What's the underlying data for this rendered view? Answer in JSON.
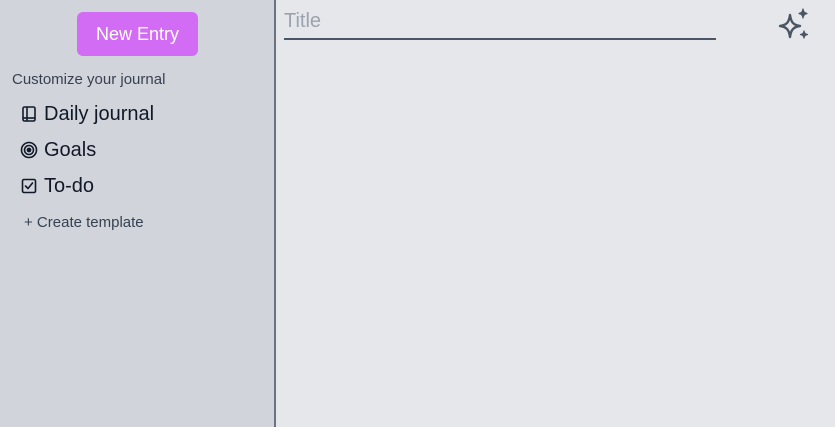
{
  "sidebar": {
    "new_entry_label": "New Entry",
    "section_label": "Customize your journal",
    "templates": [
      {
        "label": "Daily journal",
        "icon": "book-icon"
      },
      {
        "label": "Goals",
        "icon": "target-icon"
      },
      {
        "label": "To-do",
        "icon": "checkbox-icon"
      }
    ],
    "create_template_label": "+ Create template"
  },
  "editor": {
    "title_placeholder": "Title",
    "title_value": "",
    "sparkle_icon": "sparkles-icon"
  },
  "colors": {
    "accent": "#d36cf5",
    "sidebar_bg": "#d1d5db",
    "main_bg": "#e5e7eb"
  }
}
